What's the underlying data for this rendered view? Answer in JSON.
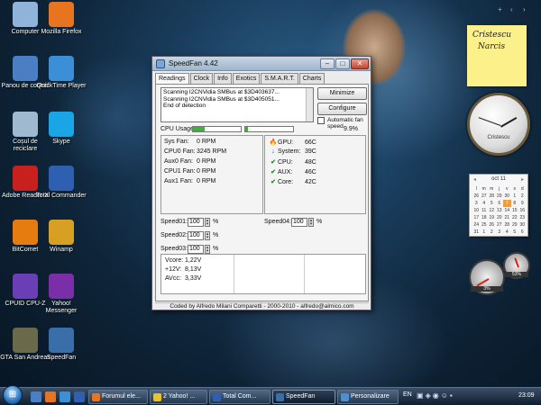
{
  "desktop": {
    "icons": [
      {
        "label": "Computer",
        "icon": "computer-icon",
        "color": "#8fb3d9"
      },
      {
        "label": "Mozilla Firefox",
        "icon": "firefox-icon",
        "color": "#e8741f"
      },
      {
        "label": "Panou de control",
        "icon": "control-panel-icon",
        "color": "#4a7fc4"
      },
      {
        "label": "QuickTime Player",
        "icon": "quicktime-icon",
        "color": "#3a8fd6"
      },
      {
        "label": "Coșul de reciclare",
        "icon": "recycle-bin-icon",
        "color": "#9fb9d0"
      },
      {
        "label": "Skype",
        "icon": "skype-icon",
        "color": "#1aa5e6"
      },
      {
        "label": "Adobe Reader X",
        "icon": "adobe-reader-icon",
        "color": "#c8201d"
      },
      {
        "label": "Total Commander",
        "icon": "total-commander-icon",
        "color": "#2f5fb0"
      },
      {
        "label": "BitComet",
        "icon": "bitcomet-icon",
        "color": "#e67b10"
      },
      {
        "label": "Winamp",
        "icon": "winamp-icon",
        "color": "#d8a022"
      },
      {
        "label": "CPUID CPU-Z",
        "icon": "cpuz-icon",
        "color": "#6a3fb5"
      },
      {
        "label": "Yahoo! Messenger",
        "icon": "yahoo-messenger-icon",
        "color": "#7a2fa8"
      },
      {
        "label": "GTA San Andreas",
        "icon": "gta-icon",
        "color": "#6a6a4a"
      },
      {
        "label": "SpeedFan",
        "icon": "speedfan-icon",
        "color": "#3a6ea8"
      }
    ]
  },
  "speedfan": {
    "title": "SpeedFan 4.42",
    "tabs": [
      "Readings",
      "Clock",
      "Info",
      "Exotics",
      "S.M.A.R.T.",
      "Charts"
    ],
    "log": [
      "Scanning I2CNVidia SMBus at $3D403637...",
      "Scanning I2CNVidia SMBus at $3D405051...",
      "End of detection"
    ],
    "buttons": {
      "minimize": "Minimize",
      "configure": "Configure"
    },
    "auto_fan_speed": "Automatic fan speed",
    "cpu_usage_label": "CPU Usage",
    "cpu_usage_pct": "9.9%",
    "cpu_bars": [
      0.25,
      0.05
    ],
    "fans": [
      {
        "name": "Sys Fan:",
        "value": "0 RPM"
      },
      {
        "name": "CPU0 Fan:",
        "value": "3245 RPM"
      },
      {
        "name": "Aux0 Fan:",
        "value": "0 RPM"
      },
      {
        "name": "CPU1 Fan:",
        "value": "0 RPM"
      },
      {
        "name": "Aux1 Fan:",
        "value": "0 RPM"
      }
    ],
    "temps": [
      {
        "name": "GPU:",
        "value": "66C",
        "icon": "fire-icon"
      },
      {
        "name": "System:",
        "value": "39C",
        "icon": "arrow-down-icon"
      },
      {
        "name": "CPU:",
        "value": "48C",
        "icon": "check-icon"
      },
      {
        "name": "AUX:",
        "value": "46C",
        "icon": "check-icon"
      },
      {
        "name": "Core:",
        "value": "42C",
        "icon": "check-icon"
      }
    ],
    "speeds": [
      {
        "name": "Speed01:",
        "value": "100",
        "unit": "%"
      },
      {
        "name": "Speed02:",
        "value": "100",
        "unit": "%"
      },
      {
        "name": "Speed03:",
        "value": "100",
        "unit": "%"
      },
      {
        "name": "Speed04:",
        "value": "100",
        "unit": "%"
      }
    ],
    "voltages": [
      {
        "name": "Vcore:",
        "value": "1,22V"
      },
      {
        "name": "+12V:",
        "value": "8,13V"
      },
      {
        "name": "AVcc:",
        "value": "3,33V"
      }
    ],
    "status": "Coded by Alfredo Milani Comparetti - 2000-2010 - alfredo@almico.com"
  },
  "gadgets": {
    "note_lines": [
      "Cristescu",
      "Narcis"
    ],
    "clock_name": "Cristescu",
    "calendar": {
      "month": "oct 11",
      "weekdays": [
        "l",
        "m",
        "m",
        "j",
        "v",
        "s",
        "d"
      ],
      "rows": [
        [
          "26",
          "27",
          "28",
          "29",
          "30",
          "1",
          "2"
        ],
        [
          "3",
          "4",
          "5",
          "6",
          "7",
          "8",
          "9"
        ],
        [
          "10",
          "11",
          "12",
          "13",
          "14",
          "15",
          "16"
        ],
        [
          "17",
          "18",
          "19",
          "20",
          "21",
          "22",
          "23"
        ],
        [
          "24",
          "25",
          "26",
          "27",
          "28",
          "29",
          "30"
        ],
        [
          "31",
          "1",
          "2",
          "3",
          "4",
          "5",
          "6"
        ]
      ],
      "today": "7"
    },
    "meters": [
      "3%",
      "53%"
    ]
  },
  "taskbar": {
    "buttons": [
      {
        "label": "Forumul ele...",
        "icon": "firefox-icon",
        "color": "#e8741f"
      },
      {
        "label": "2 Yahoo! ...",
        "icon": "yahoo-messenger-icon",
        "color": "#e9c22e"
      },
      {
        "label": "Total Com...",
        "icon": "total-commander-icon",
        "color": "#2f5fb0"
      },
      {
        "label": "SpeedFan",
        "icon": "speedfan-icon",
        "color": "#3a6ea8"
      },
      {
        "label": "Personalizare",
        "icon": "personalize-icon",
        "color": "#4f8fd0"
      }
    ],
    "lang": "EN",
    "time": "23:09"
  }
}
